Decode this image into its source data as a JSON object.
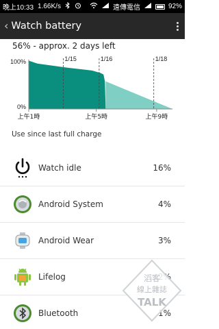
{
  "status_bar": {
    "time": "晚上10:33",
    "speed": "1.66K/s",
    "carrier": "遠傳電信",
    "battery_pct": "92%"
  },
  "action_bar": {
    "back_glyph": "‹",
    "title": "Watch battery"
  },
  "summary": "56% - approx. 2 days left",
  "chart_data": {
    "type": "area",
    "y_ticks": [
      "100%",
      "0%"
    ],
    "x_tick_labels": [
      "上午1時",
      "上午5時",
      "上午9時"
    ],
    "date_markers": [
      "1/15",
      "1/16",
      "1/18"
    ],
    "ylim": [
      0,
      100
    ],
    "series": [
      {
        "kind": "actual",
        "color": "#0a8f7f",
        "points": [
          [
            0,
            98
          ],
          [
            0.06,
            92
          ],
          [
            0.16,
            88
          ],
          [
            0.26,
            84
          ],
          [
            0.32,
            82
          ],
          [
            0.38,
            80
          ],
          [
            0.44,
            78
          ],
          [
            0.5,
            73
          ],
          [
            0.52,
            70
          ],
          [
            0.53,
            56
          ],
          [
            0.535,
            0
          ]
        ]
      },
      {
        "kind": "projected",
        "color": "#7fcfc5",
        "points": [
          [
            0.535,
            56
          ],
          [
            1.0,
            0
          ]
        ]
      }
    ],
    "legend": "none",
    "grid": false
  },
  "use_since": "Use since last full charge",
  "apps": [
    {
      "name": "Watch idle",
      "pct": "16%",
      "icon": "power-icon"
    },
    {
      "name": "Android System",
      "pct": "4%",
      "icon": "android-system-icon"
    },
    {
      "name": "Android Wear",
      "pct": "3%",
      "icon": "android-wear-icon"
    },
    {
      "name": "Lifelog",
      "pct": "2%",
      "icon": "lifelog-icon"
    },
    {
      "name": "Bluetooth",
      "pct": "1%",
      "icon": "bluetooth-icon"
    }
  ],
  "watermark": {
    "line1": "滔客",
    "line2": "線上雜誌",
    "brand": "TALK"
  }
}
